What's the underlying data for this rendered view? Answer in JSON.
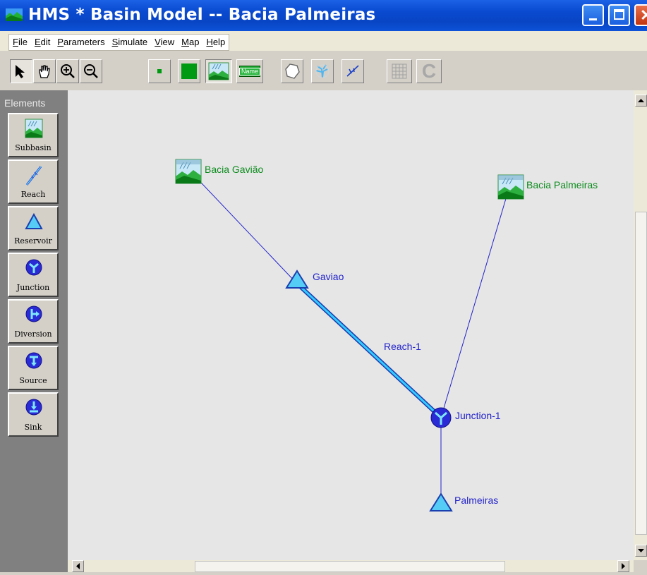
{
  "window": {
    "title": "HMS * Basin Model -- Bacia Palmeiras"
  },
  "menu": {
    "items": [
      {
        "first": "F",
        "rest": "ile"
      },
      {
        "first": "E",
        "rest": "dit"
      },
      {
        "first": "P",
        "rest": "arameters"
      },
      {
        "first": "S",
        "rest": "imulate"
      },
      {
        "first": "V",
        "rest": "iew"
      },
      {
        "first": "M",
        "rest": "ap"
      },
      {
        "first": "H",
        "rest": "elp"
      }
    ]
  },
  "toolbar": {
    "buttons": [
      "select-arrow",
      "pan-hand",
      "zoom-in",
      "zoom-out",
      "small-square",
      "large-square",
      "subbasin-view",
      "name-toggle",
      "polygon",
      "stream-network",
      "reach-lines",
      "grid",
      "clear"
    ],
    "name_button_text": "Name",
    "clear_button_text": "C"
  },
  "palette": {
    "title": "Elements",
    "items": [
      {
        "label": "Subbasin",
        "icon": "subbasin-icon"
      },
      {
        "label": "Reach",
        "icon": "reach-icon"
      },
      {
        "label": "Reservoir",
        "icon": "reservoir-icon"
      },
      {
        "label": "Junction",
        "icon": "junction-icon"
      },
      {
        "label": "Diversion",
        "icon": "diversion-icon"
      },
      {
        "label": "Source",
        "icon": "source-icon"
      },
      {
        "label": "Sink",
        "icon": "sink-icon"
      }
    ]
  },
  "basin": {
    "nodes": [
      {
        "name": "Bacia Gavião",
        "type": "subbasin"
      },
      {
        "name": "Bacia Palmeiras",
        "type": "subbasin"
      },
      {
        "name": "Gaviao",
        "type": "reservoir"
      },
      {
        "name": "Junction-1",
        "type": "junction"
      },
      {
        "name": "Palmeiras",
        "type": "reservoir"
      }
    ],
    "reach_label": "Reach-1"
  },
  "colors": {
    "titlebar": "#0a4bd1",
    "canvas": "#e6e6e6",
    "link_line": "#2222cc",
    "reach": "#33ccff",
    "subbasin_label": "#0d8c1e",
    "element_label": "#2323cc"
  }
}
